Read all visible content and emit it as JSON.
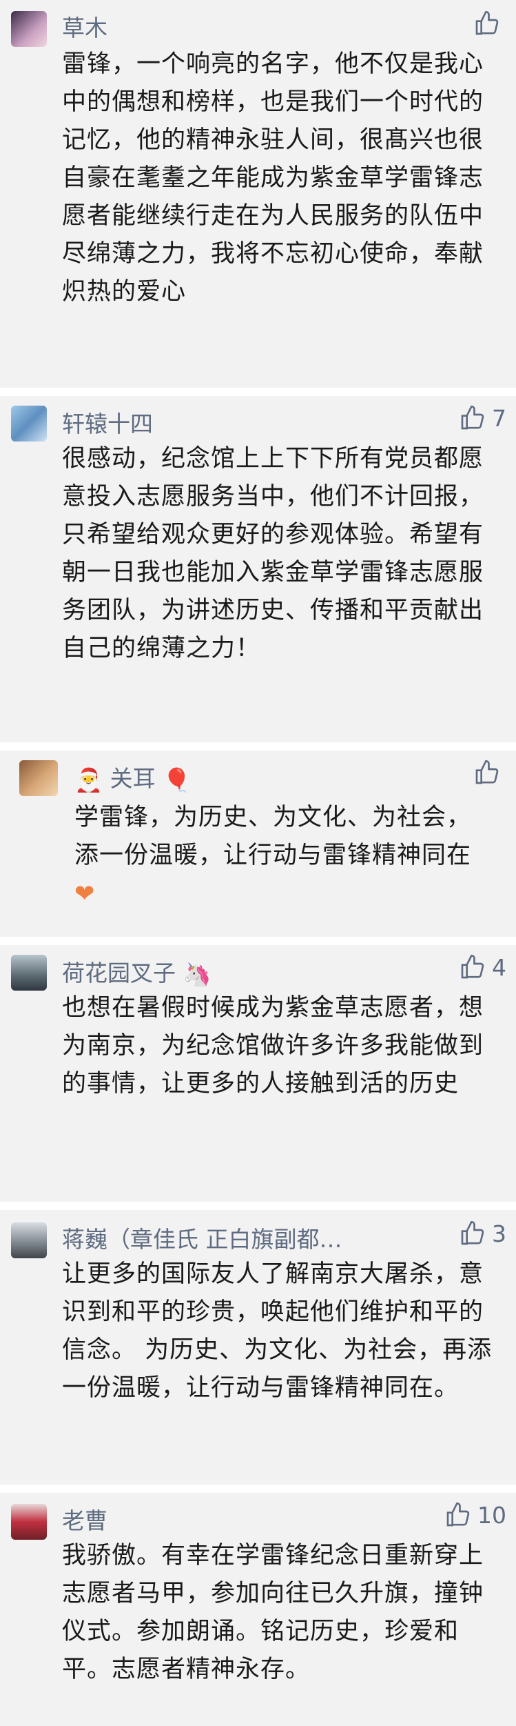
{
  "comments": [
    {
      "name": "草木",
      "likes": "",
      "text": "雷锋，一个响亮的名字，他不仅是我心中的偶想和榜样，也是我们一个时代的记忆，他的精神永驻人间，很髙兴也很自豪在耄耋之年能成为紫金草学雷锋志愿者能继续行走在为人民服务的队伍中尽绵薄之力，我将不忘初心使命，奉献炽热的爱心"
    },
    {
      "name": "轩辕十四",
      "likes": "7",
      "text": "很感动，纪念馆上上下下所有党员都愿意投入志愿服务当中，他们不计回报，只希望给观众更好的参观体验。希望有朝一日我也能加入紫金草学雷锋志愿服务团队，为讲述历史、传播和平贡献出自己的绵薄之力！"
    },
    {
      "name": "关耳",
      "likes": "",
      "text": "学雷锋，为历史、为文化、为社会，添一份温暖，让行动与雷锋精神同在"
    },
    {
      "name": "荷花园叉子",
      "likes": "4",
      "text": "也想在暑假时候成为紫金草志愿者，想为南京，为纪念馆做许多许多我能做到的事情，让更多的人接触到活的历史"
    },
    {
      "name": "蒋巍（章佳氏 正白旗副都…",
      "likes": "3",
      "text": "让更多的国际友人了解南京大屠杀，意识到和平的珍贵，唤起他们维护和平的信念。  为历史、为文化、为社会，再添一份温暖，让行动与雷锋精神同在。"
    },
    {
      "name": "老曹",
      "likes": "10",
      "text": "我骄傲。有幸在学雷锋纪念日重新穿上志愿者马甲，参加向往已久升旗，撞钟仪式。参加朗诵。铭记历史，珍爱和平。志愿者精神永存。"
    }
  ],
  "colors": {
    "card_bg": "#f2f2f2",
    "name_color": "#5f6b80",
    "text_color": "#1a1a1a"
  },
  "icons": [
    "thumbs-up-icon",
    "santa-emoji",
    "balloon-emoji",
    "unicorn-emoji",
    "orange-heart-emoji"
  ]
}
